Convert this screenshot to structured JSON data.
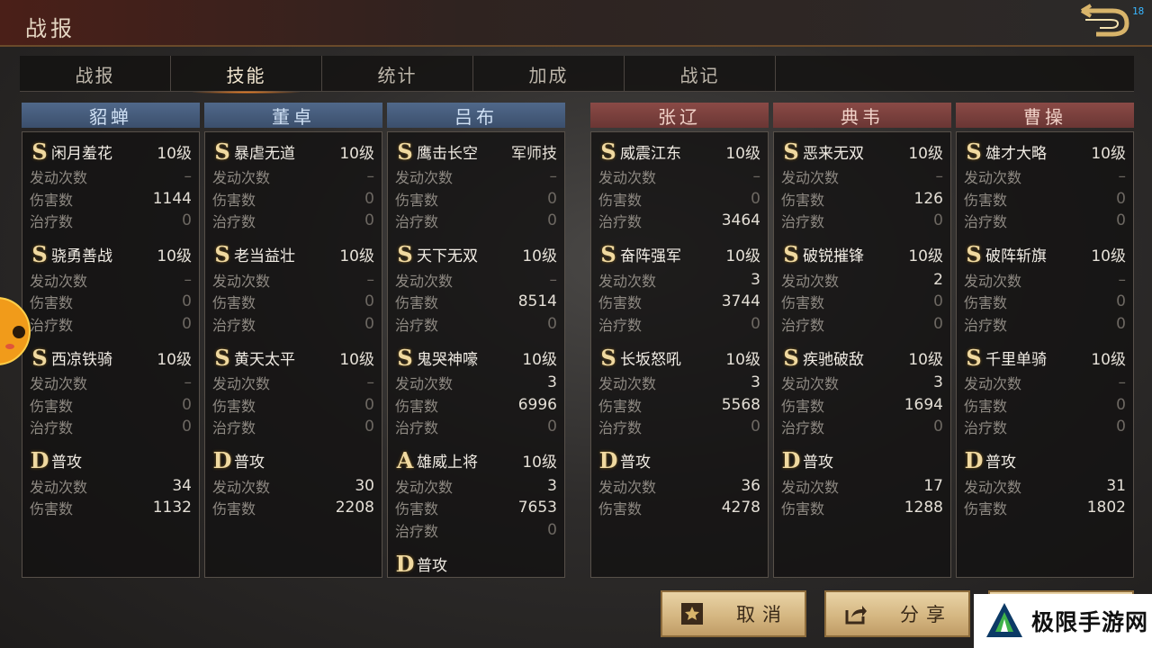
{
  "header": {
    "title": "战报",
    "fps": "18"
  },
  "tabs": [
    {
      "label": "战报",
      "active": false
    },
    {
      "label": "技能",
      "active": true
    },
    {
      "label": "统计",
      "active": false
    },
    {
      "label": "加成",
      "active": false
    },
    {
      "label": "战记",
      "active": false
    }
  ],
  "stat_labels": {
    "count": "发动次数",
    "damage": "伤害数",
    "heal": "治疗数"
  },
  "colors": {
    "blue_header": "#4a6183",
    "red_header": "#7d4440",
    "badge": "#f0d9a0",
    "button": "#d8bb86"
  },
  "generals": [
    {
      "name": "貂蝉",
      "side": "blue",
      "skills": [
        {
          "grade": "S",
          "name": "闲月羞花",
          "level": "10级",
          "count": "–",
          "damage": "1144",
          "heal": "0"
        },
        {
          "grade": "S",
          "name": "骁勇善战",
          "level": "10级",
          "count": "–",
          "damage": "0",
          "heal": "0"
        },
        {
          "grade": "S",
          "name": "西凉铁骑",
          "level": "10级",
          "count": "–",
          "damage": "0",
          "heal": "0"
        },
        {
          "grade": "D",
          "name": "普攻",
          "level": "",
          "count": "34",
          "damage": "1132"
        }
      ]
    },
    {
      "name": "董卓",
      "side": "blue",
      "skills": [
        {
          "grade": "S",
          "name": "暴虐无道",
          "level": "10级",
          "count": "–",
          "damage": "0",
          "heal": "0"
        },
        {
          "grade": "S",
          "name": "老当益壮",
          "level": "10级",
          "count": "–",
          "damage": "0",
          "heal": "0"
        },
        {
          "grade": "S",
          "name": "黄天太平",
          "level": "10级",
          "count": "–",
          "damage": "0",
          "heal": "0"
        },
        {
          "grade": "D",
          "name": "普攻",
          "level": "",
          "count": "30",
          "damage": "2208"
        }
      ]
    },
    {
      "name": "吕布",
      "side": "blue",
      "skills": [
        {
          "grade": "S",
          "name": "鹰击长空",
          "level": "军师技",
          "count": "–",
          "damage": "0",
          "heal": "0"
        },
        {
          "grade": "S",
          "name": "天下无双",
          "level": "10级",
          "count": "–",
          "damage": "8514",
          "heal": "0"
        },
        {
          "grade": "S",
          "name": "鬼哭神嚎",
          "level": "10级",
          "count": "3",
          "damage": "6996",
          "heal": "0"
        },
        {
          "grade": "A",
          "name": "雄威上将",
          "level": "10级",
          "count": "3",
          "damage": "7653",
          "heal": "0"
        },
        {
          "grade": "D",
          "name": "普攻",
          "level": ""
        }
      ]
    },
    {
      "name": "张辽",
      "side": "red",
      "skills": [
        {
          "grade": "S",
          "name": "威震江东",
          "level": "10级",
          "count": "–",
          "damage": "0",
          "heal": "3464"
        },
        {
          "grade": "S",
          "name": "奋阵强军",
          "level": "10级",
          "count": "3",
          "damage": "3744",
          "heal": "0"
        },
        {
          "grade": "S",
          "name": "长坂怒吼",
          "level": "10级",
          "count": "3",
          "damage": "5568",
          "heal": "0"
        },
        {
          "grade": "D",
          "name": "普攻",
          "level": "",
          "count": "36",
          "damage": "4278"
        }
      ]
    },
    {
      "name": "典韦",
      "side": "red",
      "skills": [
        {
          "grade": "S",
          "name": "恶来无双",
          "level": "10级",
          "count": "–",
          "damage": "126",
          "heal": "0"
        },
        {
          "grade": "S",
          "name": "破锐摧锋",
          "level": "10级",
          "count": "2",
          "damage": "0",
          "heal": "0"
        },
        {
          "grade": "S",
          "name": "疾驰破敌",
          "level": "10级",
          "count": "3",
          "damage": "1694",
          "heal": "0"
        },
        {
          "grade": "D",
          "name": "普攻",
          "level": "",
          "count": "17",
          "damage": "1288"
        }
      ]
    },
    {
      "name": "曹操",
      "side": "red",
      "skills": [
        {
          "grade": "S",
          "name": "雄才大略",
          "level": "10级",
          "count": "–",
          "damage": "0",
          "heal": "0"
        },
        {
          "grade": "S",
          "name": "破阵斩旗",
          "level": "10级",
          "count": "–",
          "damage": "0",
          "heal": "0"
        },
        {
          "grade": "S",
          "name": "千里单骑",
          "level": "10级",
          "count": "–",
          "damage": "0",
          "heal": "0"
        },
        {
          "grade": "D",
          "name": "普攻",
          "level": "",
          "count": "31",
          "damage": "1802"
        }
      ]
    }
  ],
  "buttons": {
    "cancel": "取消",
    "share": "分享"
  },
  "watermark": {
    "text": "极限手游网"
  }
}
